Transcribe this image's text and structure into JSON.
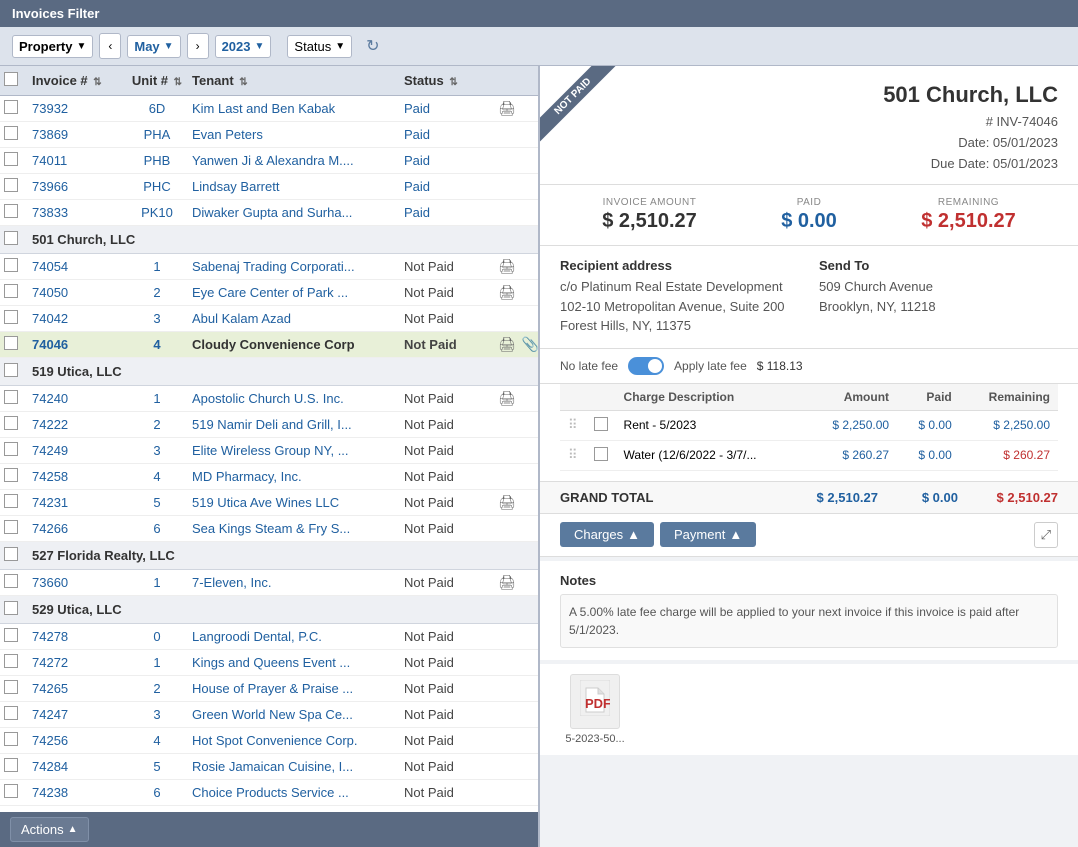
{
  "titleBar": {
    "label": "Invoices Filter"
  },
  "filterBar": {
    "propertyLabel": "Property",
    "monthLabel": "May",
    "yearLabel": "2023",
    "statusLabel": "Status",
    "prevArrow": "‹",
    "nextArrow": "›"
  },
  "table": {
    "columns": {
      "invoice": "Invoice #",
      "unit": "Unit #",
      "tenant": "Tenant",
      "status": "Status"
    },
    "groups": [
      {
        "name": "",
        "rows": [
          {
            "invoice": "73932",
            "unit": "6D",
            "tenant": "Kim Last and Ben Kabak",
            "status": "Paid",
            "hasIcon": true
          },
          {
            "invoice": "73869",
            "unit": "PHA",
            "tenant": "Evan Peters",
            "status": "Paid",
            "hasIcon": false
          },
          {
            "invoice": "74011",
            "unit": "PHB",
            "tenant": "Yanwen Ji & Alexandra M....",
            "status": "Paid",
            "hasIcon": false
          },
          {
            "invoice": "73966",
            "unit": "PHC",
            "tenant": "Lindsay Barrett",
            "status": "Paid",
            "hasIcon": false
          },
          {
            "invoice": "73833",
            "unit": "PK10",
            "tenant": "Diwaker Gupta and Surha...",
            "status": "Paid",
            "hasIcon": false
          }
        ]
      },
      {
        "name": "501 Church, LLC",
        "rows": [
          {
            "invoice": "74054",
            "unit": "1",
            "tenant": "Sabenaj Trading Corporati...",
            "status": "Not Paid",
            "hasIcon": true
          },
          {
            "invoice": "74050",
            "unit": "2",
            "tenant": "Eye Care Center of Park ...",
            "status": "Not Paid",
            "hasIcon": true
          },
          {
            "invoice": "74042",
            "unit": "3",
            "tenant": "Abul Kalam Azad",
            "status": "Not Paid",
            "hasIcon": false
          },
          {
            "invoice": "74046",
            "unit": "4",
            "tenant": "Cloudy Convenience Corp",
            "status": "Not Paid",
            "hasIcon": true,
            "selected": true,
            "hasClip": true
          }
        ]
      },
      {
        "name": "519 Utica, LLC",
        "rows": [
          {
            "invoice": "74240",
            "unit": "1",
            "tenant": "Apostolic Church U.S. Inc.",
            "status": "Not Paid",
            "hasIcon": true
          },
          {
            "invoice": "74222",
            "unit": "2",
            "tenant": "519 Namir Deli and Grill, I...",
            "status": "Not Paid",
            "hasIcon": false
          },
          {
            "invoice": "74249",
            "unit": "3",
            "tenant": "Elite Wireless Group NY, ...",
            "status": "Not Paid",
            "hasIcon": false
          },
          {
            "invoice": "74258",
            "unit": "4",
            "tenant": "MD Pharmacy, Inc.",
            "status": "Not Paid",
            "hasIcon": false
          },
          {
            "invoice": "74231",
            "unit": "5",
            "tenant": "519 Utica Ave Wines LLC",
            "status": "Not Paid",
            "hasIcon": true
          },
          {
            "invoice": "74266",
            "unit": "6",
            "tenant": "Sea Kings Steam & Fry S...",
            "status": "Not Paid",
            "hasIcon": false
          }
        ]
      },
      {
        "name": "527 Florida Realty, LLC",
        "rows": [
          {
            "invoice": "73660",
            "unit": "1",
            "tenant": "7-Eleven, Inc.",
            "status": "Not Paid",
            "hasIcon": true
          }
        ]
      },
      {
        "name": "529 Utica, LLC",
        "rows": [
          {
            "invoice": "74278",
            "unit": "0",
            "tenant": "Langroodi Dental, P.C.",
            "status": "Not Paid",
            "hasIcon": false
          },
          {
            "invoice": "74272",
            "unit": "1",
            "tenant": "Kings and Queens Event ...",
            "status": "Not Paid",
            "hasIcon": false
          },
          {
            "invoice": "74265",
            "unit": "2",
            "tenant": "House of Prayer & Praise ...",
            "status": "Not Paid",
            "hasIcon": false
          },
          {
            "invoice": "74247",
            "unit": "3",
            "tenant": "Green World New Spa Ce...",
            "status": "Not Paid",
            "hasIcon": false
          },
          {
            "invoice": "74256",
            "unit": "4",
            "tenant": "Hot Spot Convenience Corp.",
            "status": "Not Paid",
            "hasIcon": false
          },
          {
            "invoice": "74284",
            "unit": "5",
            "tenant": "Rosie Jamaican Cuisine, I...",
            "status": "Not Paid",
            "hasIcon": false
          },
          {
            "invoice": "74238",
            "unit": "6",
            "tenant": "Choice Products Service ...",
            "status": "Not Paid",
            "hasIcon": false
          }
        ]
      }
    ]
  },
  "bottomBar": {
    "actionsLabel": "Actions"
  },
  "invoice": {
    "notPaidLabel": "NOT PAID",
    "companyName": "501 Church, LLC",
    "invoiceNum": "# INV-74046",
    "date": "Date: 05/01/2023",
    "dueDate": "Due Date: 05/01/2023",
    "invoiceAmountLabel": "INVOICE AMOUNT",
    "invoiceAmount": "$ 2,510.27",
    "paidLabel": "PAID",
    "paidAmount": "$ 0.00",
    "remainingLabel": "REMAINING",
    "remainingAmount": "$ 2,510.27",
    "recipientAddressTitle": "Recipient address",
    "recipientLine1": "c/o Platinum Real Estate Development",
    "recipientLine2": "102-10 Metropolitan Avenue, Suite 200",
    "recipientLine3": "Forest Hills, NY, 11375",
    "sendToTitle": "Send To",
    "sendToLine1": "509 Church Avenue",
    "sendToLine2": "Brooklyn, NY, 11218",
    "noLateFeeLabel": "No late fee",
    "applyLateFeeLabel": "Apply late fee",
    "lateFeeAmount": "$ 118.13",
    "chargesColumns": {
      "description": "Charge Description",
      "amount": "Amount",
      "paid": "Paid",
      "remaining": "Remaining"
    },
    "charges": [
      {
        "description": "Rent - 5/2023",
        "amount": "$ 2,250.00",
        "paid": "$ 0.00",
        "remaining": "$ 2,250.00"
      },
      {
        "description": "Water (12/6/2022 - 3/7/...",
        "amount": "$ 260.27",
        "paid": "$ 0.00",
        "remaining": "$ 260.27"
      }
    ],
    "grandTotalLabel": "GRAND TOTAL",
    "grandTotalAmount": "$ 2,510.27",
    "grandTotalPaid": "$ 0.00",
    "grandTotalRemaining": "$ 2,510.27",
    "chargesButtonLabel": "Charges",
    "chargesButtonArrow": "▲",
    "paymentButtonLabel": "Payment",
    "paymentButtonArrow": "▲",
    "notesTitle": "Notes",
    "notesText": "A 5.00% late fee charge will be applied to your next invoice if this invoice is paid after 5/1/2023.",
    "attachmentName": "5-2023-50..."
  }
}
